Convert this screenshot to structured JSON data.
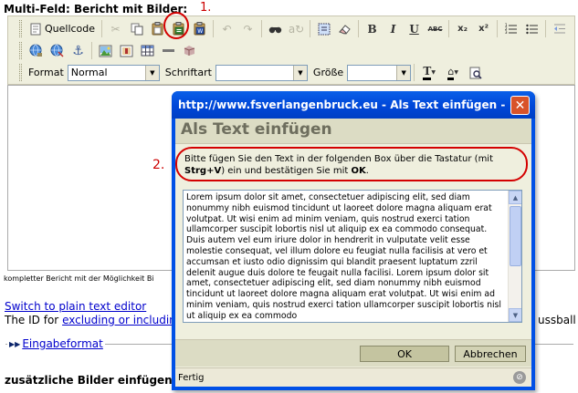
{
  "field_title": "Multi-Feld: Bericht mit Bilder:",
  "annotations": {
    "step1": "1.",
    "step2": "2."
  },
  "toolbar": {
    "source_label": "Quellcode",
    "format_label": "Format",
    "format_value": "Normal",
    "font_label": "Schriftart",
    "font_value": "",
    "size_label": "Größe",
    "size_value": "",
    "text_color_glyph": "T",
    "bg_color_glyph": "⌂",
    "btn_bold": "B",
    "btn_italic": "I",
    "btn_underline": "U",
    "btn_strike": "ABC",
    "btn_sub": "x₂",
    "btn_sup": "x²"
  },
  "page": {
    "description": "kompletter Bericht mit der Möglichkeit Bi",
    "switch_link": "Switch to plain text editor",
    "id_text": "The ID for",
    "id_link1": "excluding or including",
    "fussball": "ussball",
    "legend_marker": "▶▶",
    "legend_link": "Eingabeformat",
    "bottom_label": "zusätzliche Bilder einfügen:"
  },
  "dialog": {
    "title": "http://www.fsverlangenbruck.eu - Als Text einfügen - M...",
    "close_glyph": "✕",
    "heading": "Als Text einfügen",
    "instr_a": "Bitte fügen Sie den Text in der folgenden Box über die Tastatur (mit ",
    "instr_key": "Strg+V",
    "instr_b": ") ein und bestätigen Sie mit ",
    "instr_ok": "OK",
    "instr_c": ".",
    "textarea_value": "Lorem ipsum dolor sit amet, consectetuer adipiscing elit, sed diam nonummy nibh euismod tincidunt ut laoreet dolore magna aliquam erat volutpat. Ut wisi enim ad minim veniam, quis nostrud exerci tation ullamcorper suscipit lobortis nisl ut aliquip ex ea commodo consequat. Duis autem vel eum iriure dolor in hendrerit in vulputate velit esse molestie consequat, vel illum dolore eu feugiat nulla facilisis at vero et accumsan et iusto odio dignissim qui blandit praesent luptatum zzril delenit augue duis dolore te feugait nulla facilisi. Lorem ipsum dolor sit amet, consectetuer adipiscing elit, sed diam nonummy nibh euismod tincidunt ut laoreet dolore magna aliquam erat volutpat. Ut wisi enim ad minim veniam, quis nostrud exerci tation ullamcorper suscipit lobortis nisl ut aliquip ex ea commodo",
    "ok_label": "OK",
    "cancel_label": "Abbrechen",
    "status": "Fertig"
  }
}
